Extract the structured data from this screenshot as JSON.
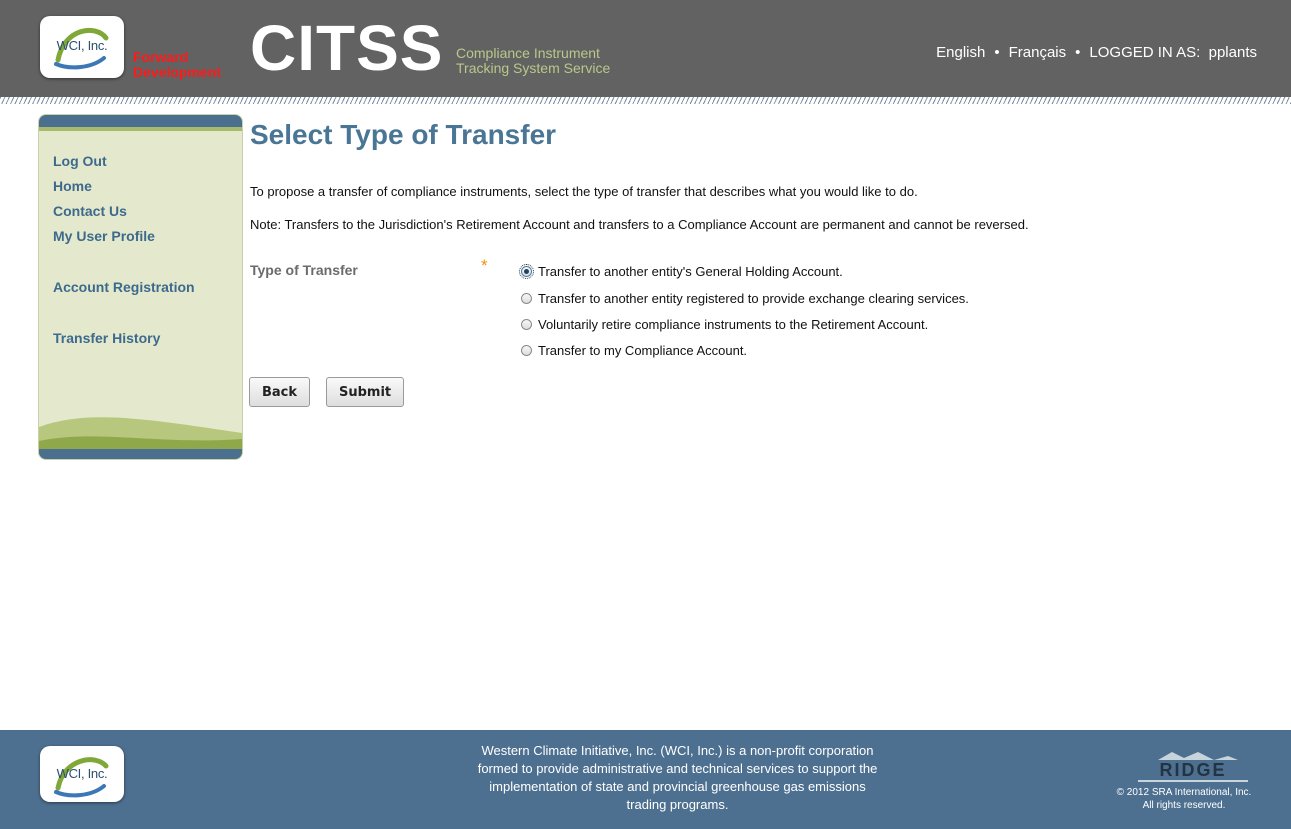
{
  "header": {
    "logo_text": "WCI, Inc.",
    "env_line1": "Forward",
    "env_line2": "Development",
    "brand": "CITSS",
    "brand_sub_line1": "Compliance Instrument",
    "brand_sub_line2": "Tracking System Service",
    "lang_english": "English",
    "lang_french": "Français",
    "logged_in_label": "LOGGED IN AS:",
    "username": "pplants",
    "colors": {
      "header_bg": "#626262",
      "env_red": "#ff1a1a",
      "brand_sub": "#b9c88b"
    }
  },
  "sidebar": {
    "items": [
      {
        "label": "Log Out"
      },
      {
        "label": "Home"
      },
      {
        "label": "Contact Us"
      },
      {
        "label": "My User Profile"
      },
      {
        "label": "Account Registration"
      },
      {
        "label": "Transfer History"
      }
    ]
  },
  "main": {
    "title": "Select Type of Transfer",
    "intro": "To propose a transfer of compliance instruments, select the type of transfer that describes what you would like to do.",
    "note": "Note: Transfers to the Jurisdiction's Retirement Account and transfers to a Compliance Account are permanent and cannot be reversed.",
    "field_label": "Type of Transfer",
    "required_marker": "*",
    "options": [
      {
        "label": "Transfer to another entity's General Holding Account.",
        "checked": true
      },
      {
        "label": "Transfer to another entity registered to provide exchange clearing services.",
        "checked": false
      },
      {
        "label": "Voluntarily retire compliance instruments to the Retirement Account.",
        "checked": false
      },
      {
        "label": "Transfer to my Compliance Account.",
        "checked": false
      }
    ],
    "back_label": "Back",
    "submit_label": "Submit",
    "colors": {
      "title": "#4a7696",
      "required": "#f29111"
    }
  },
  "footer": {
    "logo_text": "WCI, Inc.",
    "text_line1": "Western Climate Initiative, Inc. (WCI, Inc.) is a non-profit corporation",
    "text_line2": "formed to provide administrative and technical services to support the",
    "text_line3": "implementation of state and provincial greenhouse gas emissions",
    "text_line4": "trading programs.",
    "ridge_logo": "RIDGE",
    "copyright_line1": "© 2012 SRA International, Inc.",
    "copyright_line2": "All rights reserved.",
    "colors": {
      "footer_bg": "#4e7090"
    }
  }
}
